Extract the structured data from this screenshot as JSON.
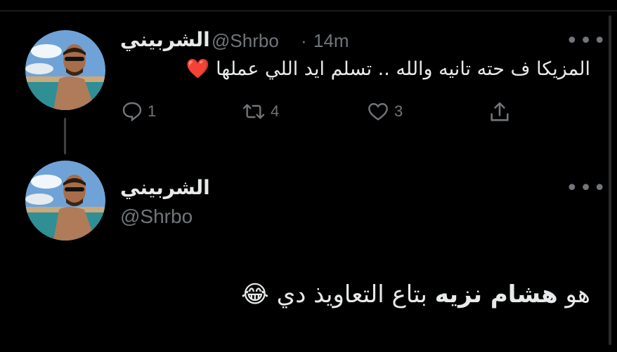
{
  "tweet1": {
    "display_name": "الشربيني",
    "handle": "@Shrbo",
    "separator": "·",
    "time": "14m",
    "text": "المزيكا ف حته تانيه والله .. تسلم ايد اللي عملها",
    "emoji": "❤️",
    "actions": {
      "replies": "1",
      "retweets": "4",
      "likes": "3"
    }
  },
  "tweet2": {
    "display_name": "الشربيني",
    "handle": "@Shrbo",
    "text_start": "هو ",
    "text_bold": "هشام نزيه",
    "text_end": " بتاع التعاويذ دي",
    "emoji": "😂"
  },
  "icons": [
    "more-icon",
    "reply-icon",
    "retweet-icon",
    "like-icon",
    "share-icon"
  ],
  "colors": {
    "background": "#000000",
    "text": "#e7e9ea",
    "secondary": "#71767b",
    "heart": "#e0245e"
  }
}
